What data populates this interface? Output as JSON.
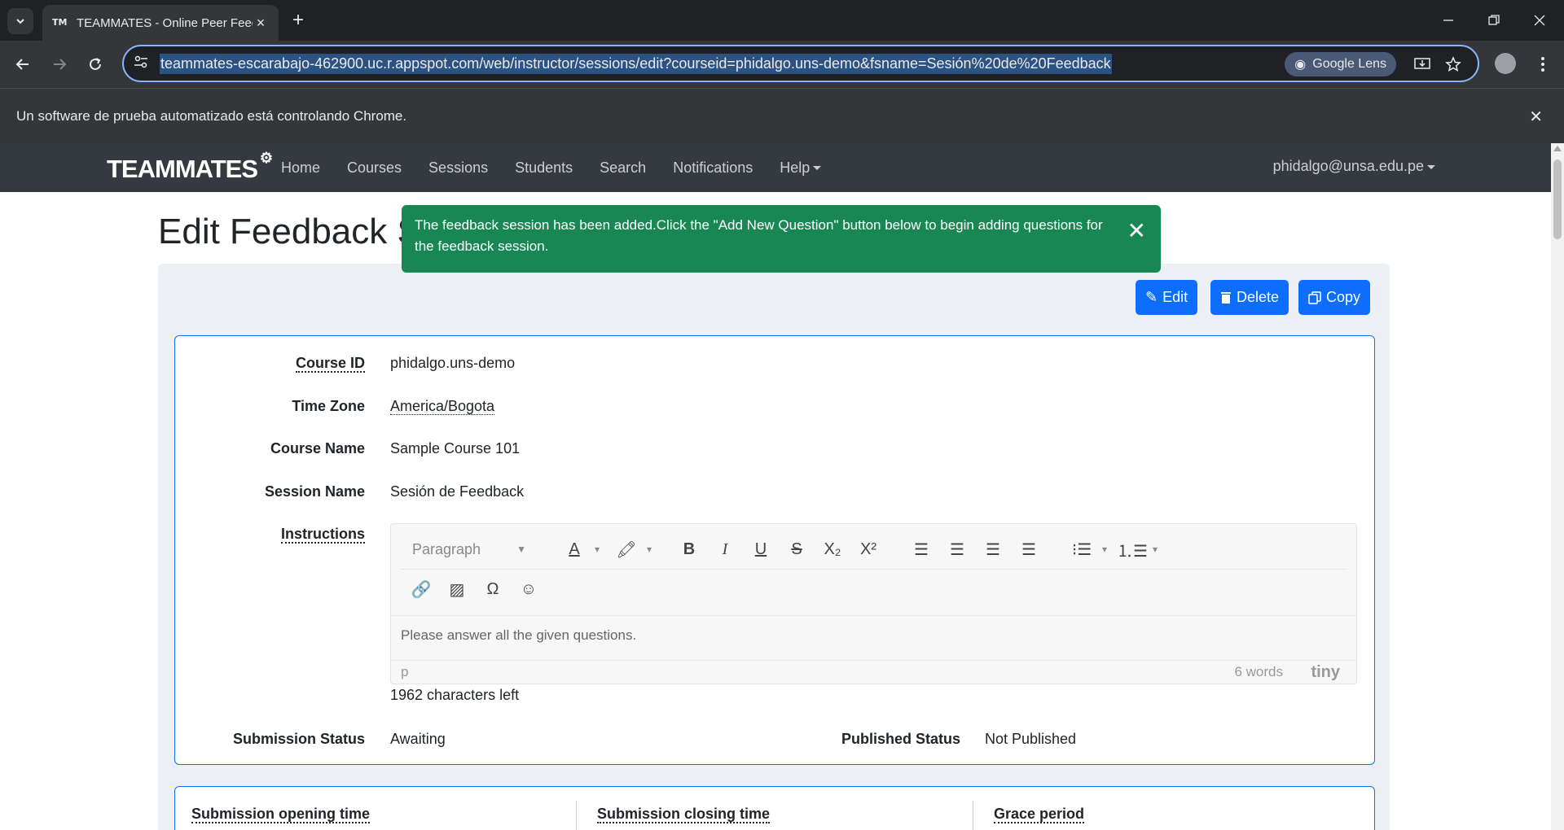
{
  "browser": {
    "tab_title": "TEAMMATES - Online Peer Feedback",
    "tab_favicon": "TM",
    "url": "teammates-escarabajo-462900.uc.r.appspot.com/web/instructor/sessions/edit?courseid=phidalgo.uns-demo&fsname=Sesión%20de%20Feedback",
    "lens_label": "Google Lens",
    "infobar_text": "Un software de prueba automatizado está controlando Chrome."
  },
  "navbar": {
    "brand": "TEAMMATES",
    "links": [
      "Home",
      "Courses",
      "Sessions",
      "Students",
      "Search",
      "Notifications",
      "Help"
    ],
    "user": "phidalgo@unsa.edu.pe"
  },
  "page": {
    "title": "Edit Feedback Session",
    "toast": "The feedback session has been added.Click the \"Add New Question\" button below to begin adding questions for the feedback session.",
    "buttons": {
      "edit": "Edit",
      "delete": "Delete",
      "copy": "Copy"
    }
  },
  "details": {
    "course_id_label": "Course ID",
    "course_id": "phidalgo.uns-demo",
    "time_zone_label": "Time Zone",
    "time_zone": "America/Bogota",
    "course_name_label": "Course Name",
    "course_name": "Sample Course 101",
    "session_name_label": "Session Name",
    "session_name": "Sesión de Feedback",
    "instructions_label": "Instructions",
    "editor": {
      "block_format": "Paragraph",
      "content": "Please answer all the given questions.",
      "path": "p",
      "word_count": "6 words",
      "branding": "tiny"
    },
    "chars_left": "1962 characters left",
    "submission_status_label": "Submission Status",
    "submission_status": "Awaiting",
    "published_status_label": "Published Status",
    "published_status": "Not Published"
  },
  "times": {
    "opening_label": "Submission opening time",
    "closing_label": "Submission closing time",
    "grace_label": "Grace period"
  },
  "colors": {
    "primary": "#0d6efd",
    "success": "#198754",
    "navbar": "#343a40"
  }
}
